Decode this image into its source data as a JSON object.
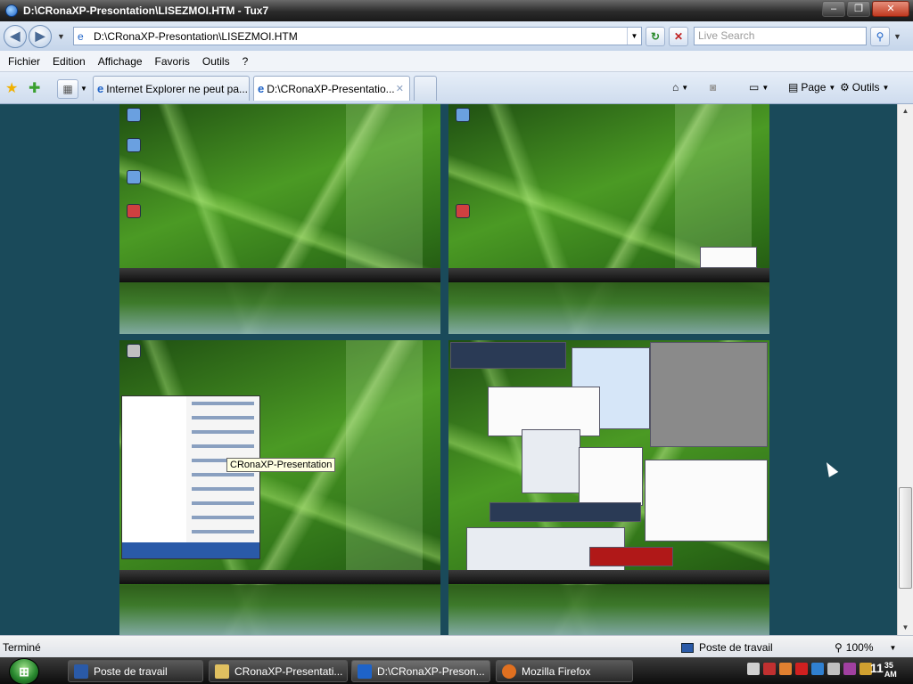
{
  "window": {
    "title": "D:\\CRonaXP-Presontation\\LISEZMOI.HTM - Tux7"
  },
  "address_bar": {
    "url": "D:\\CRonaXP-Presontation\\LISEZMOI.HTM",
    "search_placeholder": "Live Search"
  },
  "menu": [
    "Fichier",
    "Edition",
    "Affichage",
    "Favoris",
    "Outils",
    "?"
  ],
  "tabs": [
    {
      "label": "Internet Explorer ne peut pa...",
      "active": false
    },
    {
      "label": "D:\\CRonaXP-Presentatio...",
      "active": true
    }
  ],
  "commands": {
    "page": "Page",
    "tools": "Outils"
  },
  "content": {
    "tooltip": "CRonaXP-Presentation"
  },
  "status": {
    "text": "Terminé",
    "zone": "Poste de travail",
    "zoom": "100%"
  },
  "taskbar": {
    "items": [
      {
        "label": "Poste de travail",
        "icon": "computer-icon"
      },
      {
        "label": "CRonaXP-Presentati...",
        "icon": "folder-icon"
      },
      {
        "label": "D:\\CRonaXP-Preson...",
        "icon": "ie-icon"
      },
      {
        "label": "Mozilla Firefox",
        "icon": "firefox-icon"
      }
    ],
    "clock_hour": "11",
    "clock_minutes": "35",
    "clock_ampm": "AM"
  },
  "colors": {
    "page_background": "#1a4a5a",
    "accent": "#1e63c8"
  }
}
